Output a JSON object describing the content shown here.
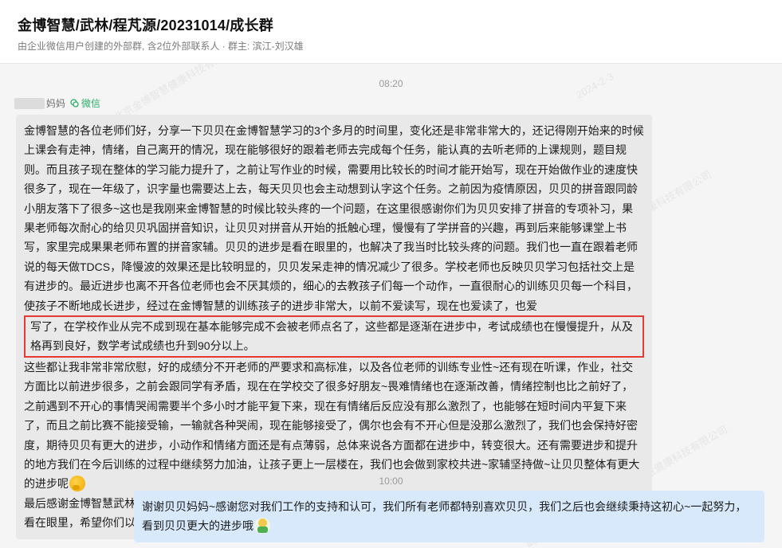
{
  "header": {
    "title": "金博智慧/武林/程芃源/20231014/成长群",
    "subtitle": "由企业微信用户创建的外部群, 含2位外部联系人 · 群主: 滨江-刘汉雄"
  },
  "messages": {
    "time1": "08:20",
    "sender_suffix": "妈妈",
    "sender_source": "微信",
    "incoming": {
      "para1_before": "金博智慧的各位老师们好，分享一下贝贝在金博智慧学习的3个多月的时间里，变化还是非常非常大的，还记得刚开始来的时候上课会有走神，情绪，自己离开的情况，现在能够很好的跟着老师去完成每个任务，能认真的去听老师的上课规则，题目规则。而且孩子现在整体的学习能力提升了，之前让写作业的时候，需要用比较长的时间才能开始写，现在开始做作业的速度快很多了，现在一年级了，识字量也需要达上去，每天贝贝也会主动想到认字这个任务。之前因为疫情原因，贝贝的拼音跟同龄小朋友落下了很多~这也是我刚来金博智慧的时候比较头疼的一个问题，在这里很感谢你们为贝贝安排了拼音的专项补习，果果老师每次耐心的给贝贝巩固拼音知识，让贝贝对拼音从开始的抵触心理，慢慢有了学拼音的兴趣，再到后来能够课堂上书写，家里完成果果老师布置的拼音家辅。贝贝的进步是看在眼里的，也解决了我当时比较头疼的问题。我们也一直在跟着老师说的每天做TDCS，降慢波的效果还是比较明显的，贝贝发呆走神的情况减少了很多。学校老师也反映贝贝学习包括社交上是有进步的。最近进步也离不开各位老师也会不厌其烦的，细心的去教孩子们每一个动作，一直很耐心的训练贝贝每一个科目，使孩子不断地成长进步，经过在金博智慧的训练孩子的进步非常大，以前不爱读写，现在也爱读了，也爱",
      "highlighted": "写了，在学校作业从完不成到现在基本能够完成不会被老师点名了，这些都是逐渐在进步中，考试成绩也在慢慢提升，从及格再到良好，数学考试成绩也升到90分以上。",
      "para1_after": "这些都让我非常非常欣慰，好的成绩分不开老师的严要求和高标准，以及各位老师的训练专业性~还有现在听课，作业，社交方面比以前进步很多，之前会跟同学有矛盾，现在在学校交了很多好朋友~畏难情绪也在逐渐改善，情绪控制也比之前好了，之前遇到不开心的事情哭闹需要半个多小时才能平复下来，现在有情绪后反应没有那么激烈了，也能够在短时间内平复下来了，而且之前比赛不能接受输，一输就各种哭闹，现在能够接受了，偶尔也会有不开心但是没那么激烈了，我们也会保持好密度，期待贝贝有更大的进步，小动作和情绪方面还是有点薄弱，总体来说各方面都在进步中，转变很大。还有需要进步和提升的地方我们在今后训练的过程中继续努力加油，让孩子更上一层楼在，我们也会做到家校共进~家辅坚持做~让贝贝整体有更大的进步呢",
      "para2": "最后感谢金博智慧武林校区果果老师，杨老师，奇奇老师，属属老师陈老师等所有老师的辛苦付出，你们的耐心的专业度我都看在眼里，希望你们以后也会越来越好！"
    },
    "time2": "10:00",
    "outgoing": "谢谢贝贝妈妈~感谢您对我们工作的支持和认可，我们所有老师都特别喜欢贝贝，我们之后也会继续秉持这初心~一起努力，看到贝贝更大的进步哦",
    "emoji_think": "thinking-face-emoji",
    "emoji_cheer": "cheer-emoji"
  },
  "watermarks": [
    "武林广场-张王巢@北京金博智慧健康科技有限公司",
    "2024-2-3"
  ],
  "colors": {
    "incoming_bubble": "#e9e9e9",
    "outgoing_bubble": "#d7e9fb",
    "highlight_border": "#e53935",
    "wechat_green": "#2aae67"
  }
}
